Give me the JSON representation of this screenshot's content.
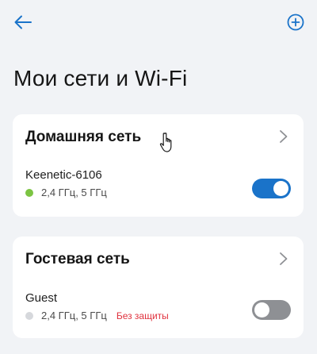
{
  "header": {
    "back_icon": "arrow-left-icon",
    "add_icon": "plus-circle-icon",
    "accent_color": "#1a73c9"
  },
  "page_title": "Мои сети и Wi-Fi",
  "networks": [
    {
      "section_title": "Домашняя сеть",
      "ssid": "Keenetic-6106",
      "bands": "2,4 ГГц, 5 ГГц",
      "status_color": "#7cc442",
      "enabled": true,
      "security_warning": ""
    },
    {
      "section_title": "Гостевая сеть",
      "ssid": "Guest",
      "bands": "2,4 ГГц, 5 ГГц",
      "status_color": "#d6d8dc",
      "enabled": false,
      "security_warning": "Без защиты"
    }
  ],
  "colors": {
    "background": "#f1f3f6",
    "card": "#ffffff",
    "toggle_on": "#1a73c9",
    "toggle_off": "#8e9094",
    "warning": "#e0313d"
  }
}
